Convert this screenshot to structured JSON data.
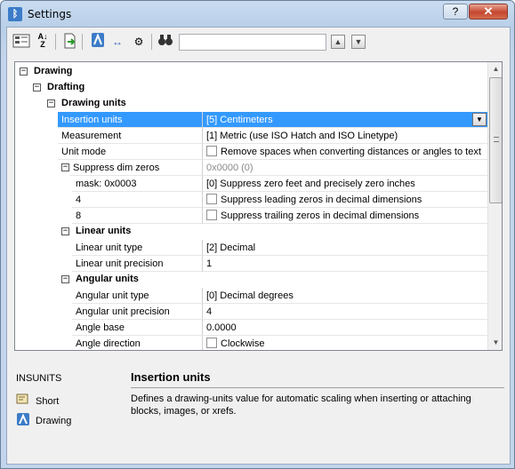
{
  "window": {
    "title": "Settings",
    "help_label": "?",
    "close_label": "✕"
  },
  "toolbar": {
    "search_value": "",
    "buttons": [
      "categorized-view",
      "alphabetical-view",
      "export",
      "drawing",
      "dimension",
      "settings",
      "find"
    ]
  },
  "tree": {
    "categories": {
      "drawing": "Drawing",
      "drafting": "Drafting",
      "drawing_units": "Drawing units",
      "linear_units": "Linear units",
      "angular_units": "Angular units"
    },
    "drawing_units": [
      {
        "name": "Insertion units",
        "value": "[5] Centimeters",
        "selected": true
      },
      {
        "name": "Measurement",
        "value": "[1] Metric (use ISO Hatch and ISO Linetype)"
      },
      {
        "name": "Unit mode",
        "value": "Remove spaces when converting distances or angles to text",
        "checkbox": true
      }
    ],
    "suppress": {
      "name": "Suppress dim zeros",
      "value": "0x0000 (0)",
      "items": [
        {
          "name": "mask: 0x0003",
          "value": "[0] Suppress zero feet and precisely zero inches"
        },
        {
          "name": "4",
          "value": "Suppress leading zeros in decimal dimensions",
          "checkbox": true
        },
        {
          "name": "8",
          "value": "Suppress trailing zeros in decimal dimensions",
          "checkbox": true
        }
      ]
    },
    "linear_units": [
      {
        "name": "Linear unit type",
        "value": "[2] Decimal"
      },
      {
        "name": "Linear unit precision",
        "value": "1"
      }
    ],
    "angular_units": [
      {
        "name": "Angular unit type",
        "value": "[0] Decimal degrees"
      },
      {
        "name": "Angular unit precision",
        "value": "4"
      },
      {
        "name": "Angle base",
        "value": "0.0000"
      },
      {
        "name": "Angle direction",
        "value": "Clockwise",
        "checkbox": true
      }
    ]
  },
  "info": {
    "variable": "INSUNITS",
    "side_items": [
      "Short",
      "Drawing"
    ],
    "title": "Insertion units",
    "description": "Defines a drawing-units value for automatic scaling when inserting or attaching blocks, images, or xrefs."
  },
  "colors": {
    "selection": "#3399ff",
    "title_gradient": "#c9dcf1",
    "close": "#c4472f"
  }
}
